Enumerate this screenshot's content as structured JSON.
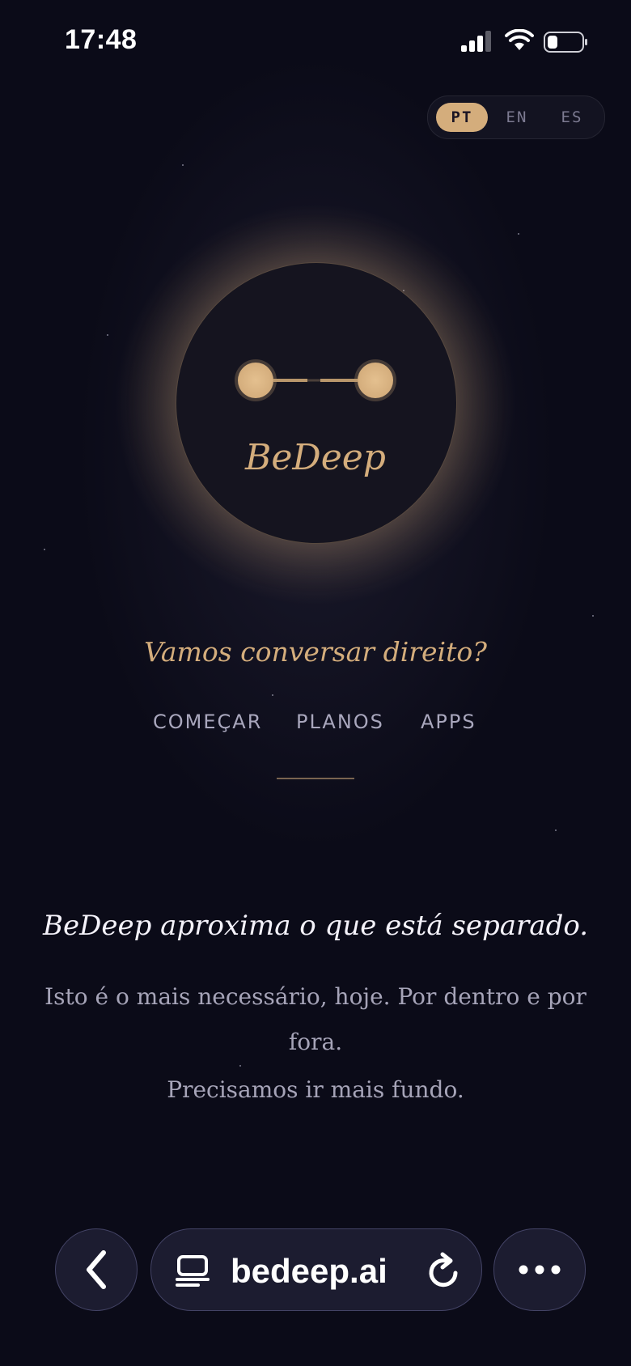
{
  "status_bar": {
    "time": "17:48",
    "icons": [
      "signal-icon",
      "wifi-icon",
      "battery-icon"
    ]
  },
  "language_switch": {
    "options": [
      "PT",
      "EN",
      "ES"
    ],
    "selected": "PT"
  },
  "logo": {
    "brand_name": "BeDeep"
  },
  "hero": {
    "tagline": "Vamos conversar direito?"
  },
  "nav": {
    "items": [
      "COMEÇAR",
      "PLANOS",
      "APPS"
    ]
  },
  "intro": {
    "headline": "BeDeep aproxima o que está separado.",
    "paragraph1": "Isto é o mais necessário, hoje. Por dentro e por fora.",
    "paragraph2": "Precisamos ir mais fundo."
  },
  "browser": {
    "url": "bedeep.ai",
    "icons": [
      "back-icon",
      "reader-icon",
      "reload-icon",
      "more-icon"
    ]
  },
  "colors": {
    "background": "#0b0b18",
    "accent": "#d4ad7c",
    "muted_text": "#a6a4b8"
  }
}
